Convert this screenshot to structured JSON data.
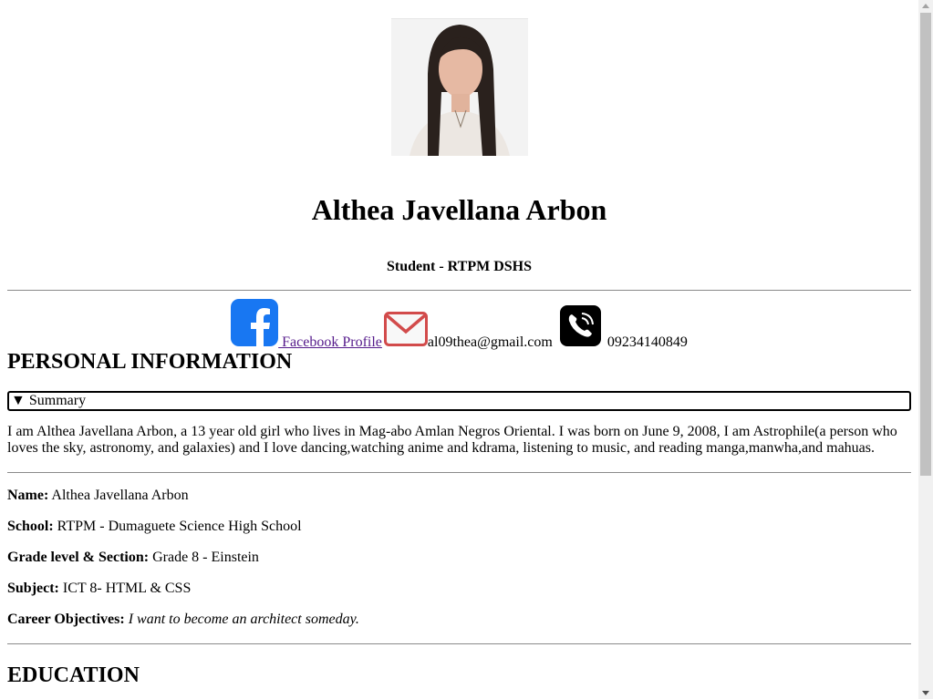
{
  "profile": {
    "name": "Althea Javellana Arbon",
    "subtitle": "Student - RTPM DSHS"
  },
  "contacts": {
    "facebook_label": " Facebook Profile ",
    "email": "al09thea@gmail.com",
    "phone": "09234140849"
  },
  "personal": {
    "heading": "PERSONAL INFORMATION",
    "summary_label": "Summary",
    "summary_text": "I am Althea Javellana Arbon, a 13 year old girl who lives in Mag-abo Amlan Negros Oriental. I was born on June 9, 2008, I am Astrophile(a person who loves the sky, astronomy, and galaxies) and I love dancing,watching anime and kdrama, listening to music, and reading manga,manwha,and mahuas.",
    "fields": [
      {
        "label": "Name:",
        "value": " Althea Javellana Arbon"
      },
      {
        "label": "School:",
        "value": " RTPM - Dumaguete Science High School"
      },
      {
        "label": "Grade level & Section:",
        "value": " Grade 8 - Einstein"
      },
      {
        "label": "Subject:",
        "value": " ICT 8- HTML & CSS"
      },
      {
        "label": "Career Objectives:",
        "value": "I want to become an architect someday."
      }
    ]
  },
  "education": {
    "heading": "EDUCATION"
  },
  "colors": {
    "facebook_blue": "#1877f2",
    "link_purple": "#551a8b",
    "mail_red": "#e05a5a"
  },
  "icons": [
    "facebook-icon",
    "mail-icon",
    "phone-icon"
  ]
}
